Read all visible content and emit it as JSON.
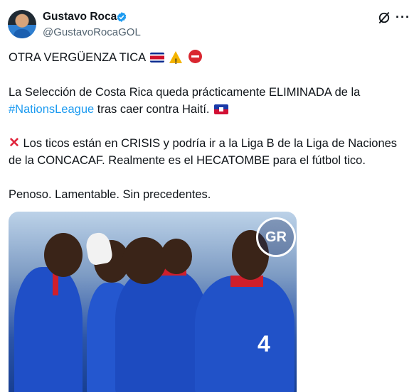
{
  "author": {
    "name": "Gustavo Roca",
    "handle": "@GustavoRocaGOL"
  },
  "tweet": {
    "line1": "OTRA VERGÜENZA TICA",
    "line2": "La Selección de Costa Rica queda prácticamente ELIMINADA de la",
    "line3_hashtag": "#NationsLeague",
    "line3_rest": " tras caer contra Haití.",
    "line4": " Los ticos están en CRISIS y podría ir a la Liga B de la Liga de Naciones",
    "line5": "de la CONCACAF. Realmente es el HECATOMBE para el fútbol tico.",
    "line6": "Penoso. Lamentable. Sin precedentes."
  },
  "media": {
    "logo_text": "GR",
    "jersey_number": "4"
  },
  "icons": {
    "verified": "verified-badge-icon",
    "grok": "grok-icon",
    "more": "more-options-icon",
    "cross": "cross-mark-icon",
    "warning": "warning-icon",
    "no_entry": "no-entry-icon",
    "flag_cr": "costa-rica-flag-icon",
    "flag_ht": "haiti-flag-icon"
  },
  "colors": {
    "link": "#1d9bf0",
    "secondary_text": "#536471",
    "verified": "#1d9bf0"
  }
}
